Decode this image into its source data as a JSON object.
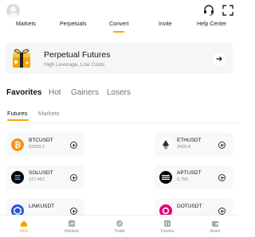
{
  "header": {
    "avatar_icon": "user-avatar-icon",
    "right_icons": [
      "headset-icon",
      "expand-scan-icon"
    ]
  },
  "quicknav": {
    "items": [
      {
        "label": "Markets",
        "active": false
      },
      {
        "label": "Perpetuals",
        "active": false
      },
      {
        "label": "Convert",
        "active": true
      },
      {
        "label": "Invite",
        "active": false
      },
      {
        "label": "Help Center",
        "active": false
      }
    ],
    "accent": "#f7a600"
  },
  "banner": {
    "title": "Perpetual Futures",
    "subtitle": "High Leverage, Low Costs",
    "arrow_icon": "arrow-right-icon"
  },
  "category_tabs": [
    {
      "label": "Favorites",
      "active": true
    },
    {
      "label": "Hot",
      "active": false
    },
    {
      "label": "Gainers",
      "active": false
    },
    {
      "label": "Losers",
      "active": false
    }
  ],
  "sub_tabs": [
    {
      "label": "Futures",
      "active": true
    },
    {
      "label": "Markets",
      "active": false
    }
  ],
  "favorites": [
    {
      "symbol": "BTCUSDT",
      "price": "63209.1",
      "icon": "bitcoin-icon",
      "color": "#f7931a"
    },
    {
      "symbol": "ETHUSDT",
      "price": "3420.4",
      "icon": "ethereum-icon",
      "color": "#ffffff"
    },
    {
      "symbol": "SOLUSDT",
      "price": "127.452",
      "icon": "solana-icon",
      "color": "#000000"
    },
    {
      "symbol": "APTUSDT",
      "price": "6.755",
      "icon": "aptos-icon",
      "color": "#000000"
    },
    {
      "symbol": "LINKUSDT",
      "price": "",
      "icon": "chainlink-icon",
      "color": "#2a5ada"
    },
    {
      "symbol": "DOTUSDT",
      "price": "",
      "icon": "polkadot-icon",
      "color": "#e6007a"
    }
  ],
  "bottom_nav": [
    {
      "label": "REX",
      "icon": "home-icon",
      "active": true
    },
    {
      "label": "Markets",
      "icon": "markets-icon",
      "active": false
    },
    {
      "label": "Trade",
      "icon": "trade-icon",
      "active": false
    },
    {
      "label": "Futures",
      "icon": "futures-icon",
      "active": false
    },
    {
      "label": "Asset",
      "icon": "wallet-icon",
      "active": false
    }
  ]
}
